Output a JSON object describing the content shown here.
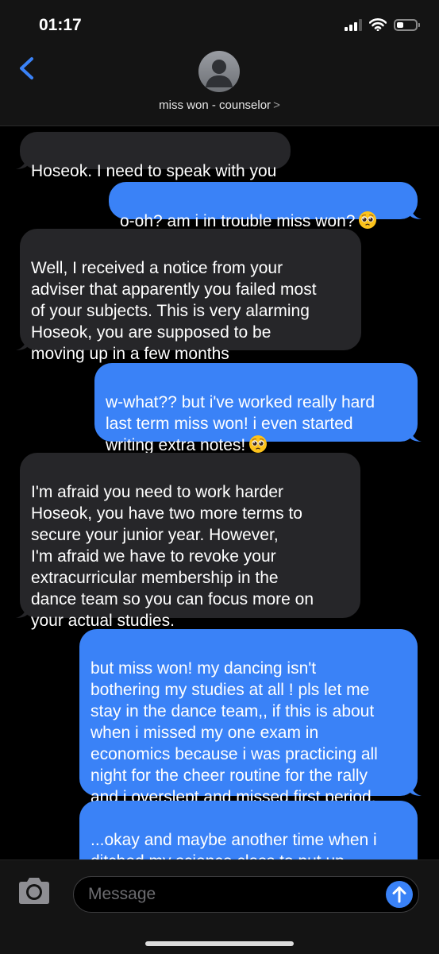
{
  "status_bar": {
    "time": "01:17",
    "battery_level": 0.35
  },
  "contact": {
    "name": "miss won - counselor",
    "chevron": ">"
  },
  "messages": [
    {
      "from": "them",
      "text": "Hoseok. I need to speak with you"
    },
    {
      "from": "me",
      "text": "o-oh? am i in trouble miss won?",
      "emoji": "pleading-face"
    },
    {
      "from": "them",
      "text": "Well, I received a notice from your\nadviser that apparently you failed most\nof your subjects. This is very alarming\nHoseok, you are supposed to be\nmoving up in a few months"
    },
    {
      "from": "me",
      "text": "w-what?? but i've worked really hard\nlast term miss won! i even started\nwriting extra notes!",
      "emoji": "pleading-face"
    },
    {
      "from": "them",
      "text": "I'm afraid you need to work harder\nHoseok, you have two more terms to\nsecure your   junior year.         However,\nI'm afraid we have to revoke your\nextracurricular membership in the\ndance team so you can focus more on\nyour actual studies."
    },
    {
      "from": "me",
      "text": "but miss won! my dancing isn't\nbothering my studies at all ! pls let me\nstay in the dance team,, if this is about\nwhen i missed my one exam in\neconomics because i was practicing all\nnight for the cheer routine for the rally\nand i overslept and missed first period,\nit was only one time!"
    },
    {
      "from": "me",
      "text": "...okay and maybe another time when i\nditched my science class to put up"
    }
  ],
  "composer": {
    "placeholder": "Message"
  },
  "colors": {
    "sent": "#3a82f7",
    "received": "#262629",
    "background": "#000000"
  }
}
